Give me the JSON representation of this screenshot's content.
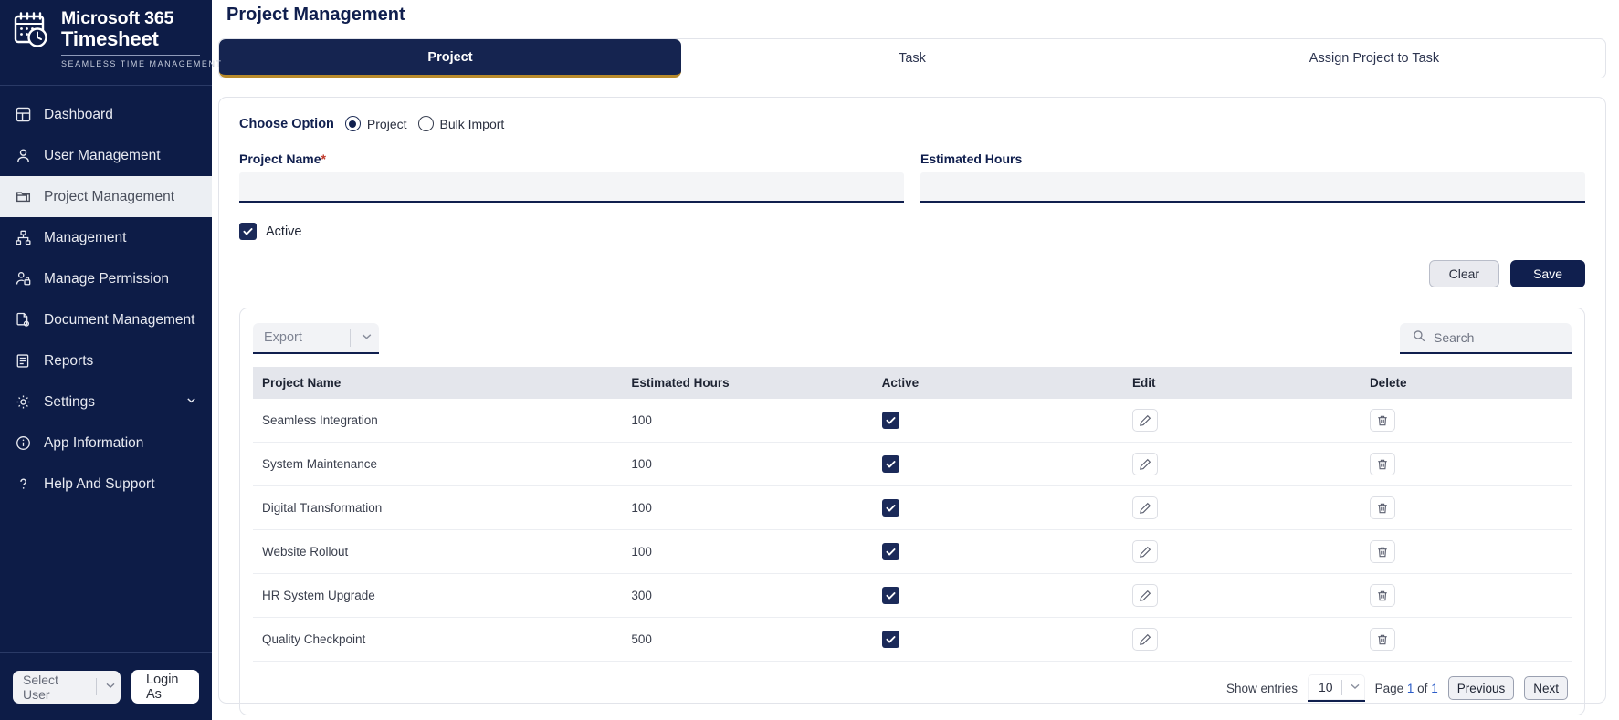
{
  "brand": {
    "line1": "Microsoft 365",
    "line2": "Timesheet",
    "tagline": "SEAMLESS TIME MANAGEMENT",
    "logo_icon": "calendar-clock-icon"
  },
  "sidebar": {
    "items": [
      {
        "label": "Dashboard",
        "icon": "dashboard-icon",
        "active": false
      },
      {
        "label": "User Management",
        "icon": "user-icon",
        "active": false
      },
      {
        "label": "Project Management",
        "icon": "folder-icon",
        "active": true
      },
      {
        "label": "Management",
        "icon": "hierarchy-icon",
        "active": false
      },
      {
        "label": "Manage Permission",
        "icon": "user-lock-icon",
        "active": false
      },
      {
        "label": "Document Management",
        "icon": "document-gear-icon",
        "active": false
      },
      {
        "label": "Reports",
        "icon": "report-icon",
        "active": false
      },
      {
        "label": "Settings",
        "icon": "gear-icon",
        "active": false,
        "chevron": "chevron-down-icon"
      },
      {
        "label": "App Information",
        "icon": "info-icon",
        "active": false
      },
      {
        "label": "Help And Support",
        "icon": "question-icon",
        "active": false
      }
    ],
    "footer": {
      "select_user_label": "Select User",
      "select_user_chevron": "chevron-down-icon",
      "login_as_label": "Login As"
    }
  },
  "header": {
    "title": "Project Management"
  },
  "tabs": [
    {
      "label": "Project",
      "active": true
    },
    {
      "label": "Task",
      "active": false
    },
    {
      "label": "Assign Project to Task",
      "active": false
    }
  ],
  "form": {
    "choose_option_label": "Choose Option",
    "options": [
      {
        "label": "Project",
        "selected": true
      },
      {
        "label": "Bulk Import",
        "selected": false
      }
    ],
    "project_name": {
      "label": "Project Name",
      "required_mark": "*",
      "value": "",
      "placeholder": ""
    },
    "estimated_hours": {
      "label": "Estimated Hours",
      "value": "",
      "placeholder": ""
    },
    "active_checkbox": {
      "label": "Active",
      "checked": true,
      "icon": "check-icon"
    },
    "clear_button": "Clear",
    "save_button": "Save"
  },
  "toolbar": {
    "export_label": "Export",
    "export_chevron": "chevron-down-icon",
    "search_placeholder": "Search",
    "search_value": "",
    "search_icon": "search-icon"
  },
  "table": {
    "columns": [
      "Project Name",
      "Estimated Hours",
      "Active",
      "Edit",
      "Delete"
    ],
    "edit_icon": "pencil-icon",
    "delete_icon": "trash-icon",
    "check_icon": "check-icon",
    "rows": [
      {
        "project_name": "Seamless Integration",
        "estimated_hours": "100",
        "active": true
      },
      {
        "project_name": "System Maintenance",
        "estimated_hours": "100",
        "active": true
      },
      {
        "project_name": "Digital Transformation",
        "estimated_hours": "100",
        "active": true
      },
      {
        "project_name": "Website Rollout",
        "estimated_hours": "100",
        "active": true
      },
      {
        "project_name": "HR System Upgrade",
        "estimated_hours": "300",
        "active": true
      },
      {
        "project_name": "Quality Checkpoint",
        "estimated_hours": "500",
        "active": true
      }
    ]
  },
  "pagination": {
    "show_entries_label": "Show entries",
    "entries_value": "10",
    "entries_chevron": "chevron-down-icon",
    "page_text_prefix": "Page",
    "current_page": "1",
    "page_text_middle": "of",
    "total_pages": "1",
    "previous_label": "Previous",
    "next_label": "Next"
  },
  "colors": {
    "sidebar_bg": "#0d1c47",
    "accent_navy": "#101f4e",
    "tab_active_underline": "#b98b2b",
    "required_red": "#c0392b",
    "page_link_blue": "#2b5cc8"
  }
}
